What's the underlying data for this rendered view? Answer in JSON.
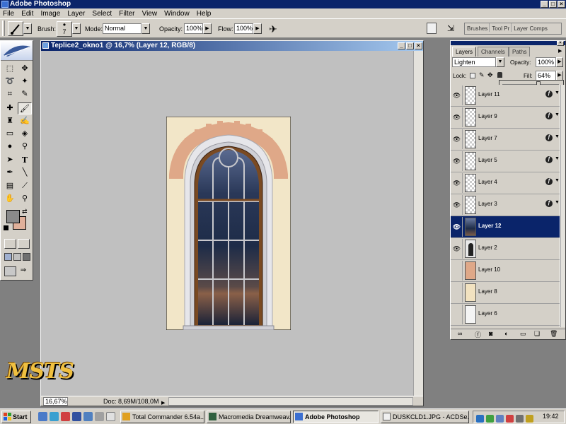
{
  "app": {
    "title": "Adobe Photoshop"
  },
  "menu": [
    "File",
    "Edit",
    "Image",
    "Layer",
    "Select",
    "Filter",
    "View",
    "Window",
    "Help"
  ],
  "options": {
    "brush_label": "Brush:",
    "brush_size": "7",
    "mode_label": "Mode:",
    "mode_value": "Normal",
    "opacity_label": "Opacity:",
    "opacity_value": "100%",
    "flow_label": "Flow:",
    "flow_value": "100%",
    "palette_well": [
      "Brushes",
      "Tool Pr",
      "Layer Comps"
    ]
  },
  "document": {
    "title": "Teplice2_okno1 @ 16,7% (Layer 12, RGB/8)",
    "zoom": "16,67%",
    "doc_info": "Doc: 8,69M/108,0M"
  },
  "layers_panel": {
    "tabs": [
      "Layers",
      "Channels",
      "Paths"
    ],
    "blend_mode": "Lighten",
    "opacity_label": "Opacity:",
    "opacity_value": "100%",
    "lock_label": "Lock:",
    "fill_label": "Fill:",
    "fill_value": "64%",
    "fill_level": 0.64,
    "layers": [
      {
        "name": "Layer 11",
        "visible": true,
        "fx": true,
        "thumb": "checker-arch",
        "selected": false
      },
      {
        "name": "Layer 9",
        "visible": true,
        "fx": true,
        "thumb": "checker",
        "selected": false
      },
      {
        "name": "Layer 7",
        "visible": true,
        "fx": true,
        "thumb": "checker",
        "selected": false
      },
      {
        "name": "Layer 5",
        "visible": true,
        "fx": true,
        "thumb": "checker",
        "selected": false
      },
      {
        "name": "Layer 4",
        "visible": true,
        "fx": true,
        "thumb": "checker-line",
        "selected": false
      },
      {
        "name": "Layer 3",
        "visible": true,
        "fx": true,
        "thumb": "checker",
        "selected": false
      },
      {
        "name": "Layer 12",
        "visible": true,
        "fx": false,
        "thumb": "sky",
        "selected": true
      },
      {
        "name": "Layer 2",
        "visible": true,
        "fx": false,
        "thumb": "window",
        "selected": false
      },
      {
        "name": "Layer 10",
        "visible": false,
        "fx": false,
        "thumb": "salmon",
        "selected": false
      },
      {
        "name": "Layer 8",
        "visible": false,
        "fx": false,
        "thumb": "beige",
        "selected": false
      },
      {
        "name": "Layer 6",
        "visible": false,
        "fx": false,
        "thumb": "white",
        "selected": false
      }
    ]
  },
  "desktop": {
    "logo_text": "MSTS"
  },
  "taskbar": {
    "start_label": "Start",
    "tasks": [
      {
        "label": "Total Commander 6.54a...",
        "active": false
      },
      {
        "label": "Macromedia Dreamweav...",
        "active": false
      },
      {
        "label": "Adobe Photoshop",
        "active": true
      },
      {
        "label": "DUSKCLD1.JPG - ACDSe...",
        "active": false
      }
    ],
    "clock": "19:42"
  },
  "colors": {
    "title_bar": "#0a246a",
    "face": "#d4d0c8",
    "selection": "#0a246a",
    "foreground_swatch": "#8a8a8a",
    "background_swatch": "#e0b09a"
  }
}
